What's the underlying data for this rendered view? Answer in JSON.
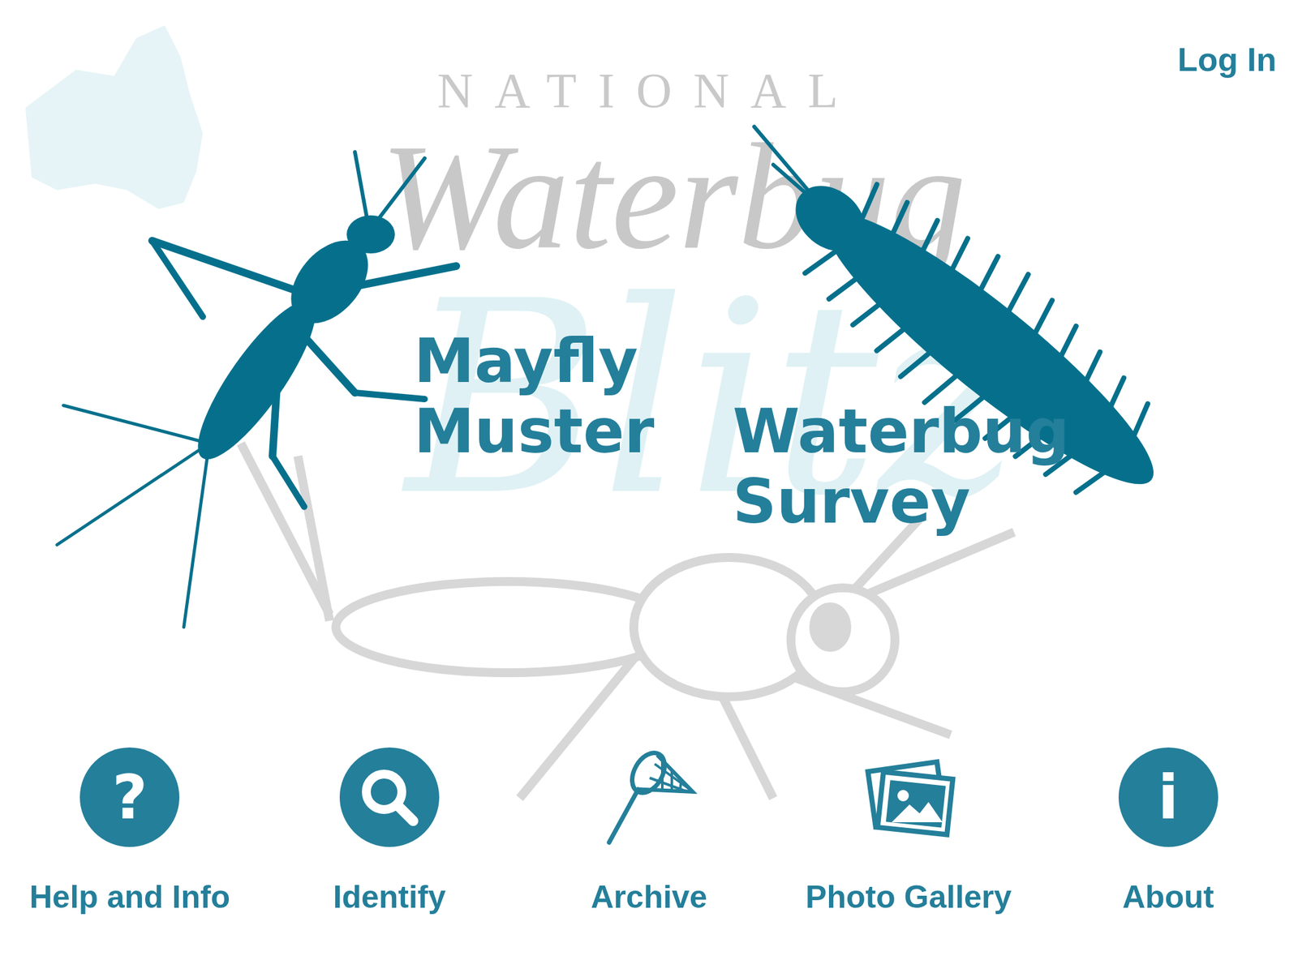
{
  "header": {
    "login": "Log In"
  },
  "logo": {
    "top": "NATIONAL",
    "script": "Waterbug",
    "accent": "Blitz"
  },
  "programs": [
    {
      "lines": [
        "Mayfly",
        "Muster"
      ]
    },
    {
      "lines": [
        "Waterbug",
        "Survey"
      ]
    }
  ],
  "nav": [
    {
      "label": "Help and Info",
      "kind": "glyph",
      "glyph": "?"
    },
    {
      "label": "Identify",
      "kind": "search"
    },
    {
      "label": "Archive",
      "kind": "net"
    },
    {
      "label": "Photo Gallery",
      "kind": "photos"
    },
    {
      "label": "About",
      "kind": "glyph",
      "glyph": "i"
    }
  ]
}
